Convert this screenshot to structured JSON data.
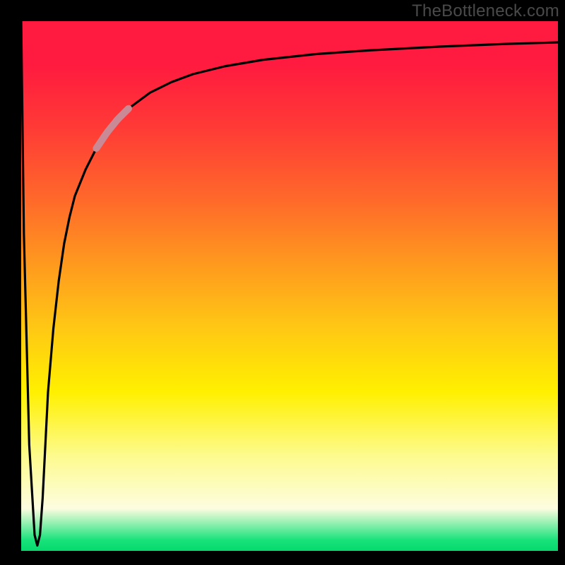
{
  "watermark": "TheBottleneck.com",
  "chart_data": {
    "type": "line",
    "title": "",
    "xlabel": "",
    "ylabel": "",
    "xlim": [
      0,
      100
    ],
    "ylim": [
      0,
      100
    ],
    "gradient_stops": [
      {
        "pos": 0,
        "color": "#ff1a3f"
      },
      {
        "pos": 20,
        "color": "#ff3a36"
      },
      {
        "pos": 40,
        "color": "#ff8a22"
      },
      {
        "pos": 60,
        "color": "#ffd210"
      },
      {
        "pos": 78,
        "color": "#fff000"
      },
      {
        "pos": 90,
        "color": "#fdfce0"
      },
      {
        "pos": 100,
        "color": "#05d96e"
      }
    ],
    "series": [
      {
        "name": "bottleneck-curve",
        "x": [
          0,
          0.5,
          1.5,
          2.5,
          3.0,
          3.5,
          4.0,
          4.5,
          5.0,
          6,
          7,
          8,
          9,
          10,
          12,
          14,
          16,
          18,
          20,
          24,
          28,
          32,
          38,
          45,
          55,
          65,
          78,
          90,
          100
        ],
        "y": [
          100,
          60,
          20,
          3,
          1,
          3,
          10,
          20,
          30,
          42,
          51,
          58,
          63,
          67,
          72,
          76,
          79,
          81.5,
          83.5,
          86.5,
          88.5,
          90,
          91.5,
          92.7,
          93.8,
          94.5,
          95.2,
          95.7,
          96
        ]
      }
    ],
    "highlight_segment": {
      "series": "bottleneck-curve",
      "x_start": 14,
      "x_end": 20,
      "color": "#c98a95",
      "width": 10
    },
    "annotations": []
  }
}
